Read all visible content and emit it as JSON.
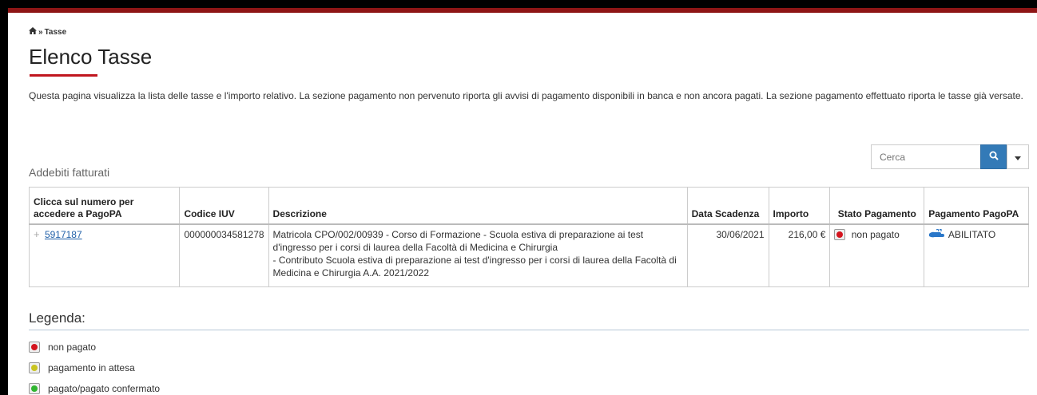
{
  "breadcrumb": {
    "home_icon": "home-icon",
    "separator": "»",
    "current": "Tasse"
  },
  "page": {
    "title": "Elenco Tasse",
    "intro": "Questa pagina visualizza la lista delle tasse e l'importo relativo. La sezione pagamento non pervenuto riporta gli avvisi di pagamento disponibili in banca e non ancora pagati. La sezione pagamento effettuato riporta le tasse già versate."
  },
  "section": {
    "label": "Addebiti fatturati"
  },
  "search": {
    "placeholder": "Cerca"
  },
  "table": {
    "headers": {
      "numero": "Clicca sul numero per accedere a PagoPA",
      "iuv": "Codice IUV",
      "descrizione": "Descrizione",
      "scadenza": "Data Scadenza",
      "importo": "Importo",
      "stato": "Stato Pagamento",
      "pagopa": "Pagamento PagoPA"
    },
    "rows": [
      {
        "numero": "5917187",
        "iuv": "000000034581278",
        "descrizione_1": "Matricola CPO/002/00939 - Corso di Formazione - Scuola estiva di preparazione ai test d'ingresso per i corsi di laurea della Facoltà di Medicina e Chirurgia",
        "descrizione_2": "- Contributo Scuola estiva di preparazione ai test d'ingresso per i corsi di laurea della Facoltà di Medicina e Chirurgia A.A. 2021/2022",
        "scadenza": "30/06/2021",
        "importo": "216,00 €",
        "stato": "non pagato",
        "stato_color": "#d4141e",
        "pagopa": "ABILITATO"
      }
    ]
  },
  "legend": {
    "title": "Legenda:",
    "items": [
      {
        "label": "non pagato",
        "color": "#d4141e"
      },
      {
        "label": "pagamento in attesa",
        "color": "#c9c420"
      },
      {
        "label": "pagato/pagato confermato",
        "color": "#2fb52f"
      }
    ]
  },
  "colors": {
    "brand": "#8e1515",
    "accent_red": "#c0161e",
    "button_blue": "#337ab7",
    "link": "#1f5fa8"
  }
}
